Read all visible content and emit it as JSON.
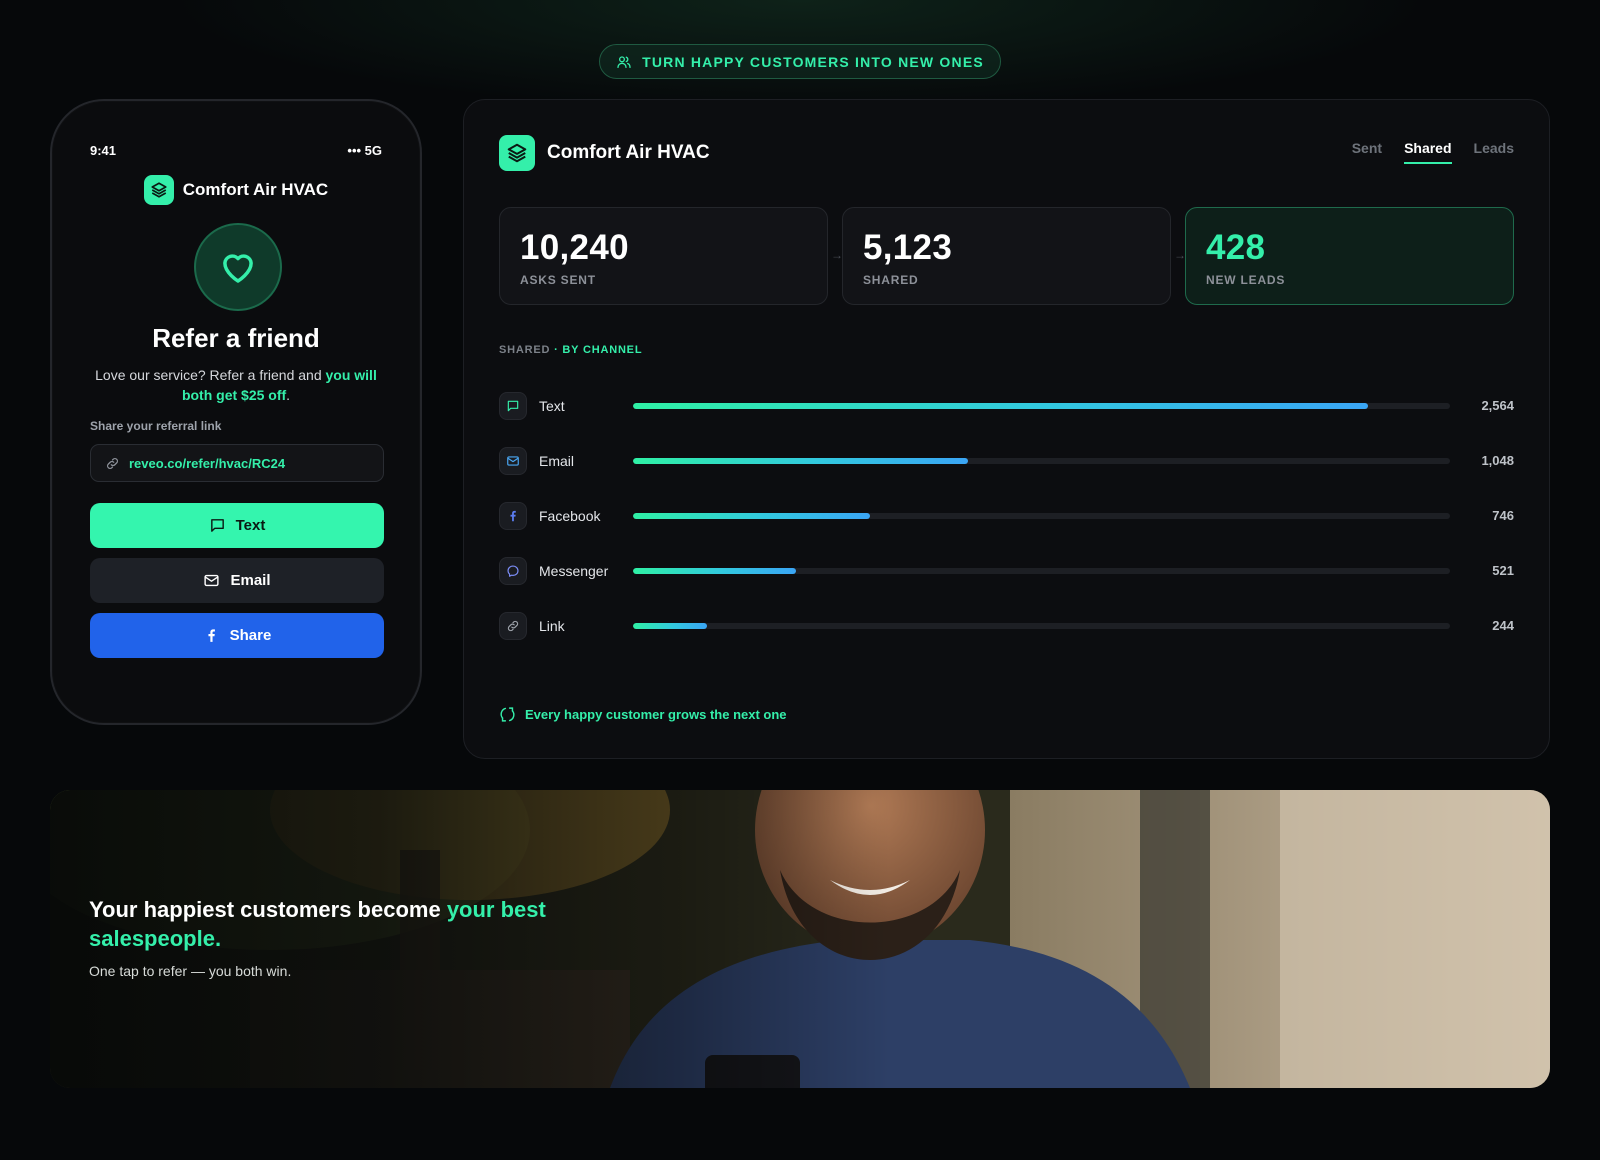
{
  "pill": {
    "label": "TURN HAPPY CUSTOMERS INTO NEW ONES",
    "icon": "users-icon"
  },
  "phone": {
    "time": "9:41",
    "signal": "••• 5G",
    "brand": "Comfort Air HVAC",
    "title": "Refer a friend",
    "desc_prefix": "Love our service? Refer a friend and ",
    "desc_accent": "you will both get $25 off",
    "desc_suffix": ".",
    "share_label": "Share your referral link",
    "link": "reveo.co/refer/hvac/RC24",
    "buttons": {
      "text": "Text",
      "email": "Email",
      "share": "Share"
    }
  },
  "dashboard": {
    "brand": "Comfort Air HVAC",
    "tabs": [
      "Sent",
      "Shared",
      "Leads"
    ],
    "active_tab": "Shared",
    "stats": [
      {
        "value": "10,240",
        "label": "ASKS SENT"
      },
      {
        "value": "5,123",
        "label": "SHARED"
      },
      {
        "value": "428",
        "label": "NEW LEADS"
      }
    ],
    "section_label": "SHARED",
    "section_accent": "· BY CHANNEL",
    "channels": [
      {
        "name": "Text",
        "value": "2,564",
        "share": 0.9,
        "icon": "chat-icon"
      },
      {
        "name": "Email",
        "value": "1,048",
        "share": 0.41,
        "icon": "mail-icon"
      },
      {
        "name": "Facebook",
        "value": "746",
        "share": 0.29,
        "icon": "facebook-icon"
      },
      {
        "name": "Messenger",
        "value": "521",
        "share": 0.2,
        "icon": "messenger-icon"
      },
      {
        "name": "Link",
        "value": "244",
        "share": 0.09,
        "icon": "link-icon"
      }
    ],
    "footer_note": "Every happy customer grows the next one"
  },
  "hero": {
    "title_prefix": "Your happiest customers become ",
    "title_accent": "your best salespeople.",
    "subtitle": "One tap to refer — you both win."
  },
  "colors": {
    "accent": "#34efaa",
    "share_blue": "#2163ea",
    "background": "#050607"
  }
}
